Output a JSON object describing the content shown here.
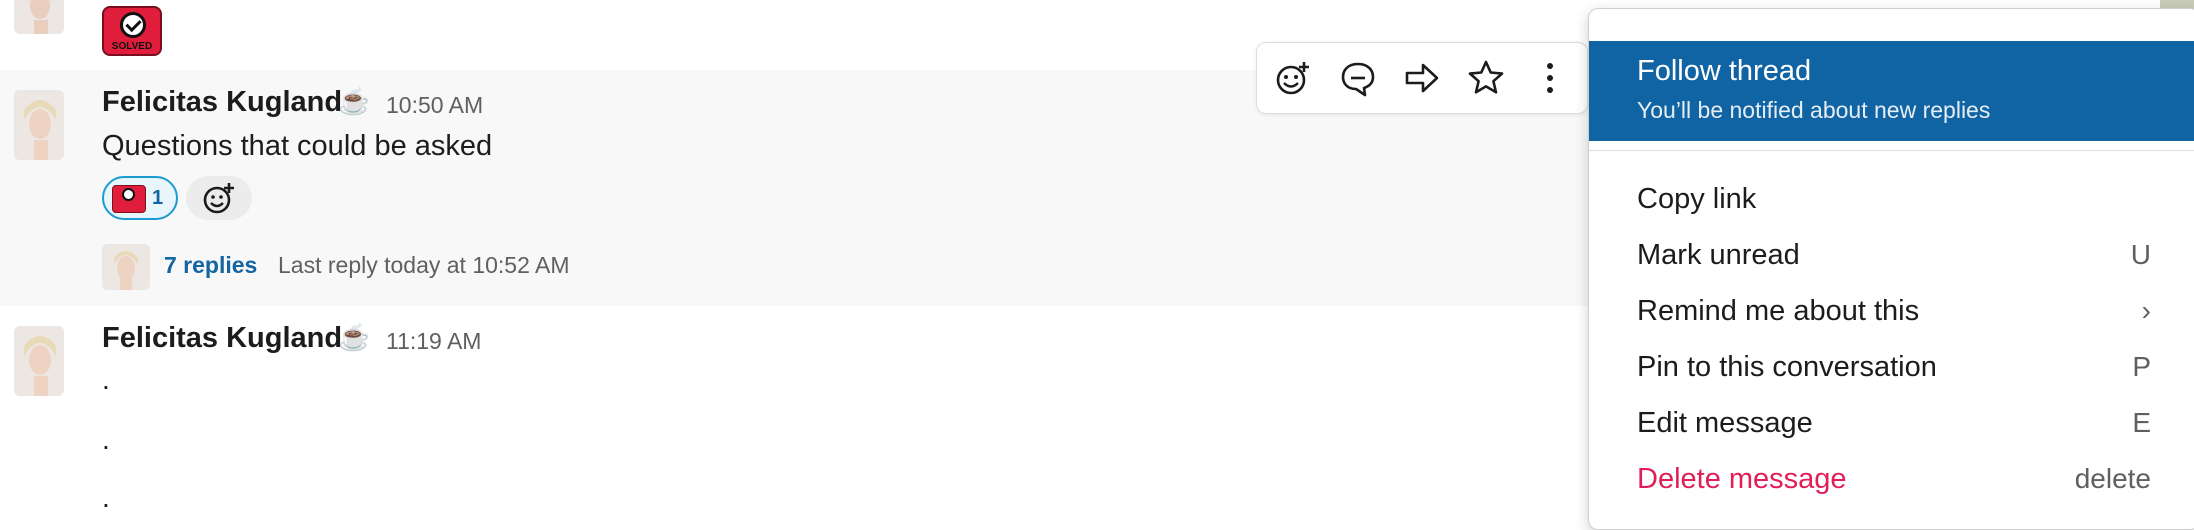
{
  "messages": [
    {
      "author": "Felicitas Kugland",
      "status_emoji": "☕",
      "time": "10:50 AM",
      "text": "Questions that could be asked",
      "reactions": [
        {
          "emoji": "solved",
          "count": "1"
        }
      ],
      "thread": {
        "replies_label": "7 replies",
        "last_reply": "Last reply today at 10:52 AM"
      }
    },
    {
      "author": "Felicitas Kugland",
      "status_emoji": "☕",
      "time": "11:19 AM",
      "lines": [
        ".",
        ".",
        "."
      ]
    }
  ],
  "badge": {
    "label": "SOLVED"
  },
  "toolbar": {
    "buttons": [
      "add-reaction-icon",
      "reply-in-thread-icon",
      "forward-icon",
      "save-star-icon",
      "more-actions-icon"
    ]
  },
  "menu": {
    "highlighted": {
      "title": "Follow thread",
      "subtitle": "You’ll be notified about new replies"
    },
    "items": [
      {
        "label": "Copy link",
        "shortcut": ""
      },
      {
        "label": "Mark unread",
        "shortcut": "U"
      },
      {
        "label": "Remind me about this",
        "shortcut": "›"
      },
      {
        "label": "Pin to this conversation",
        "shortcut": "P"
      },
      {
        "label": "Edit message",
        "shortcut": "E"
      },
      {
        "label": "Delete message",
        "shortcut": "delete"
      }
    ]
  },
  "colors": {
    "accent": "#1164a3",
    "danger": "#e01e5a",
    "link": "#1264a3"
  }
}
